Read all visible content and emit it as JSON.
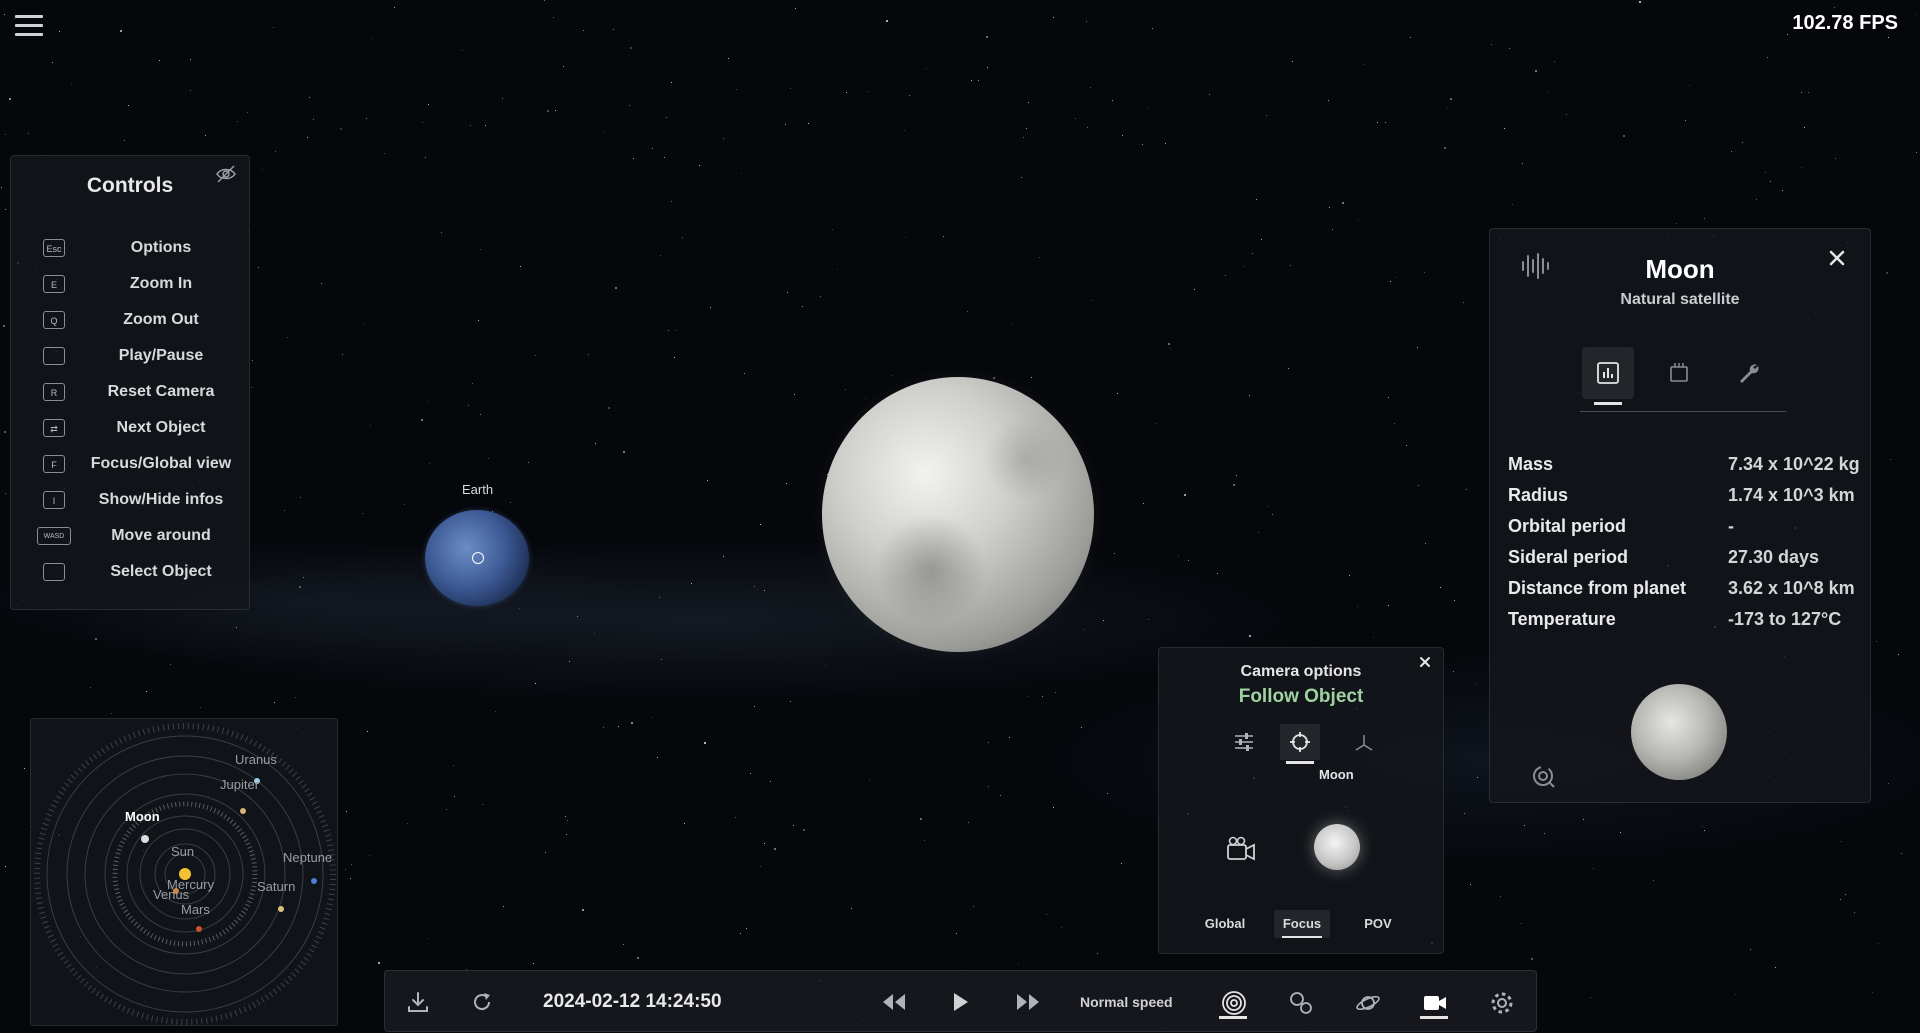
{
  "fps": "102.78 FPS",
  "earth_label": "Earth",
  "controls": {
    "title": "Controls",
    "items": [
      {
        "key": "Esc",
        "label": "Options"
      },
      {
        "key": "E",
        "label": "Zoom In"
      },
      {
        "key": "Q",
        "label": "Zoom Out"
      },
      {
        "key": "",
        "label": "Play/Pause"
      },
      {
        "key": "R",
        "label": "Reset Camera"
      },
      {
        "key": "⇄",
        "label": "Next Object"
      },
      {
        "key": "F",
        "label": "Focus/Global view"
      },
      {
        "key": "I",
        "label": "Show/Hide infos"
      },
      {
        "key": "WASD",
        "label": "Move around"
      },
      {
        "key": "",
        "label": "Select Object"
      }
    ]
  },
  "minimap": {
    "labels": [
      "Uranus",
      "Jupiter",
      "Moon",
      "Sun",
      "Neptune",
      "Mercury",
      "Venus",
      "Saturn",
      "Mars"
    ]
  },
  "info": {
    "name": "Moon",
    "type": "Natural satellite",
    "stats": [
      {
        "name": "Mass",
        "value": "7.34 x 10^22 kg"
      },
      {
        "name": "Radius",
        "value": "1.74 x 10^3 km"
      },
      {
        "name": "Orbital period",
        "value": "-"
      },
      {
        "name": "Sideral period",
        "value": "27.30 days"
      },
      {
        "name": "Distance from planet",
        "value": "3.62 x 10^8 km"
      },
      {
        "name": "Temperature",
        "value": "-173 to 127°C"
      }
    ]
  },
  "camera": {
    "title": "Camera options",
    "mode": "Follow Object",
    "target": "Moon",
    "modes": [
      "Global",
      "Focus",
      "POV"
    ],
    "active_mode": "Focus"
  },
  "bottombar": {
    "datetime": "2024-02-12 14:24:50",
    "speed": "Normal speed"
  },
  "colors": {
    "accent_green": "#9fd2a0",
    "panel_bg": "#14161b"
  }
}
